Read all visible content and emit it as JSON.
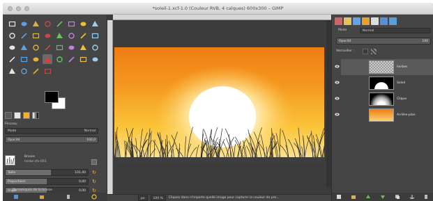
{
  "window": {
    "title": "*soleil-1.xcf-1.0 (Couleur RVB, 4 calques) 600x300 – GIMP"
  },
  "toolbox": {
    "tools": [
      "rect-select-icon",
      "ellipse-select-icon",
      "free-select-icon",
      "fuzzy-select-icon",
      "color-select-icon",
      "scissors-icon",
      "foreground-select-icon",
      "paths-icon",
      "color-picker-icon",
      "zoom-icon",
      "measure-icon",
      "move-icon",
      "align-icon",
      "crop-icon",
      "rotate-icon",
      "scale-icon",
      "shear-icon",
      "perspective-icon",
      "flip-icon",
      "cage-icon",
      "warp-icon",
      "text-icon",
      "bucket-fill-icon",
      "blend-icon",
      "pencil-icon",
      "paintbrush-icon",
      "eraser-icon",
      "airbrush-icon",
      "ink-icon",
      "clone-icon",
      "heal-icon",
      "perspective-clone-icon",
      "blur-icon",
      "smudge-icon",
      "dodge-icon",
      "burn-icon"
    ],
    "active_tool_index": 27,
    "options_title": "Pinceau",
    "mode_label": "Mode",
    "mode_value": "Normal",
    "opacity_label": "Opacité",
    "opacity_value": "100,0",
    "brush_label": "Brosse",
    "brush_name": "herbe-sfx-003",
    "size_label": "Taille",
    "size_value": "101,40",
    "size_fraction": 0.55,
    "aspect_label": "Proportions",
    "aspect_value": "0,00",
    "aspect_fraction": 0.5,
    "angle_label": "Angle",
    "angle_value": "0,00",
    "angle_fraction": 0.5,
    "dynamics_label": "Dynamiques de la brosse"
  },
  "canvas": {
    "unit": "px",
    "zoom": "100 %",
    "status_message": "Cliquez dans n'importe quelle image pour capturer la couleur de pre…"
  },
  "dock": {
    "mode_label": "Mode",
    "mode_value": "Normal",
    "opacity_label": "Opacité",
    "opacity_value": "100",
    "lock_label": "Verrouiller :",
    "layers": [
      {
        "name": "herbes",
        "thumb": "transparent",
        "visible": true,
        "selected": true
      },
      {
        "name": "Soleil",
        "thumb": "sun",
        "visible": true,
        "selected": false
      },
      {
        "name": "Clique",
        "thumb": "halo",
        "visible": true,
        "selected": false
      },
      {
        "name": "Arrière-plan",
        "thumb": "gradient",
        "visible": true,
        "selected": false
      }
    ]
  },
  "colors": {
    "accent": "#f0c030",
    "foreground": "#000000",
    "background": "#ffffff"
  }
}
